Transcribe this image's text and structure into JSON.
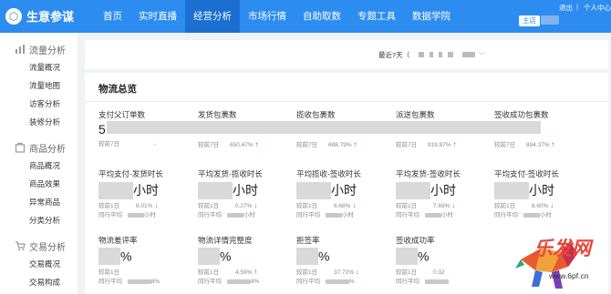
{
  "app": {
    "logo_mark": "⬡",
    "title": "生意参谋"
  },
  "nav": [
    "首页",
    "实时直播",
    "经营分析",
    "市场行情",
    "自助取数",
    "专题工具",
    "数据学院"
  ],
  "topbar": {
    "shop_btn": "主店",
    "logout": "退出",
    "separator": "|",
    "user": "个人中心"
  },
  "sidebar": [
    {
      "group": "流量分析",
      "icon": "flow-icon",
      "items": [
        "流量概况",
        "流量地图",
        "访客分析",
        "装修分析"
      ]
    },
    {
      "group": "商品分析",
      "icon": "goods-icon",
      "items": [
        "商品概况",
        "商品效果",
        "异常商品",
        "分类分析"
      ]
    },
    {
      "group": "交易分析",
      "icon": "cart-icon",
      "items": [
        "交易概况",
        "交易构成"
      ]
    }
  ],
  "date_bar": {
    "range_label": "最近7天（",
    "chevron": "⌵"
  },
  "panel": {
    "title": "物流总览"
  },
  "row1": [
    {
      "label": "支付父订单数",
      "value": "5",
      "cmp": "较前7日",
      "pct": "-",
      "arrow": ""
    },
    {
      "label": "发货包裹数",
      "value": "",
      "cmp": "较前7日",
      "pct": "650.47%",
      "arrow": "↑"
    },
    {
      "label": "揽收包裹数",
      "value": "",
      "cmp": "较前7日",
      "pct": "698.79%",
      "arrow": "↑"
    },
    {
      "label": "派送包裹数",
      "value": "",
      "cmp": "较前7日",
      "pct": "919.87%",
      "arrow": "↑"
    },
    {
      "label": "签收成功包裹数",
      "value": "",
      "cmp": "较前7日",
      "pct": "894.37%",
      "arrow": "↑"
    }
  ],
  "row2": [
    {
      "label": "平均支付-发货时长",
      "unit": "小时",
      "cmp": "较前1日",
      "pct": "8.01%",
      "arrow": "↓",
      "avg": "同行平均",
      "avg_tail": "小时"
    },
    {
      "label": "平均发货-揽收时长",
      "unit": "小时",
      "cmp": "较前1日",
      "pct": "0.27%",
      "arrow": "↓",
      "avg": "同行平均",
      "avg_tail": "小时"
    },
    {
      "label": "平均揽收-签收时长",
      "unit": "小时",
      "cmp": "较前1日",
      "pct": "6.68%",
      "arrow": "↓",
      "avg": "同行平均",
      "avg_tail": "小时"
    },
    {
      "label": "平均发货-签收时长",
      "unit": "小时",
      "cmp": "较前1日",
      "pct": "7.69%",
      "arrow": "↓",
      "avg": "同行平均",
      "avg_tail": "小时"
    },
    {
      "label": "平均支付-签收时长",
      "unit": "小时",
      "cmp": "较前1日",
      "pct": "8.60%",
      "arrow": "↓",
      "avg": "同行平均",
      "avg_tail": "小时"
    }
  ],
  "row3": [
    {
      "label": "物流差评率",
      "unit": "%",
      "cmp": "较前1日",
      "pct": "",
      "arrow": "",
      "avg": "同行平均",
      "avg_tail": "8%"
    },
    {
      "label": "物流详情完整度",
      "unit": "%",
      "cmp": "较前1日",
      "pct": "4.59%",
      "arrow": "↑",
      "avg": "同行平均",
      "avg_tail": "4%"
    },
    {
      "label": "拒签率",
      "unit": "%",
      "cmp": "较前1日",
      "pct": "37.72%",
      "arrow": "↓",
      "avg": "同行平均",
      "avg_tail": "%"
    },
    {
      "label": "签收成功率",
      "unit": "%",
      "cmp": "较前1日",
      "pct": "0.32",
      "arrow": "",
      "avg": "同行平均",
      "avg_tail": ""
    }
  ],
  "watermark": {
    "text": "乐发网",
    "url": "www.6pf.cn"
  },
  "colors": {
    "primary": "#2d8cf0",
    "up": "#f5222d",
    "down": "#19be6b"
  }
}
